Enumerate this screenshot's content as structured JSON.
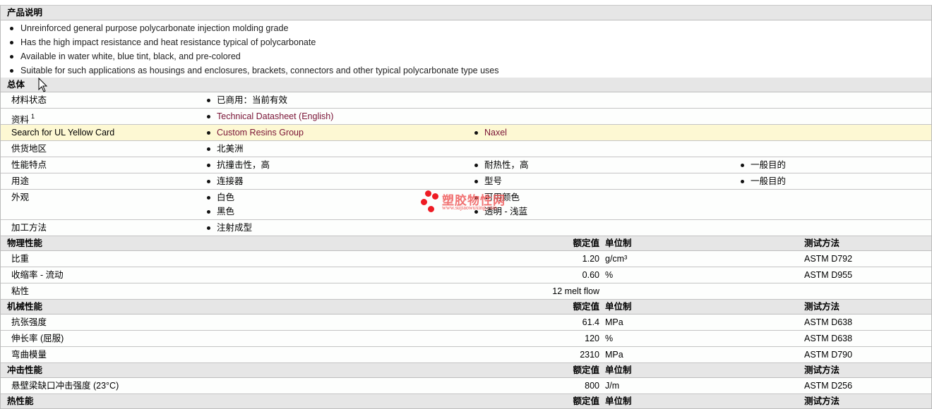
{
  "description": {
    "title": "产品说明",
    "items": [
      "Unreinforced general purpose polycarbonate injection molding grade",
      "Has the high impact resistance and heat resistance typical of polycarbonate",
      "Available in water white, blue tint, black, and pre-colored",
      "Suitable for such applications as housings and enclosures, brackets, connectors and other typical polycarbonate type uses"
    ]
  },
  "general": {
    "title": "总体",
    "rows": [
      {
        "label": "材料状态",
        "values": [
          "已商用：当前有效"
        ]
      },
      {
        "label": "资料",
        "sup": "1",
        "values": [
          "Technical Datasheet (English)"
        ]
      },
      {
        "label": "Search for UL Yellow Card",
        "values": [
          "Custom Resins Group",
          "Naxel"
        ]
      },
      {
        "label": "供货地区",
        "values": [
          "北美洲"
        ]
      },
      {
        "label": "性能特点",
        "values": [
          "抗撞击性，高",
          "耐热性，高",
          "一般目的"
        ]
      },
      {
        "label": "用途",
        "values": [
          "连接器",
          "型号",
          "一般目的"
        ]
      },
      {
        "label": "外观",
        "values": [
          "白色",
          "黑色",
          "可用颜色",
          "透明 - 浅蓝"
        ]
      },
      {
        "label": "加工方法",
        "values": [
          "注射成型"
        ]
      }
    ]
  },
  "col_headers": {
    "value": "额定值",
    "unit": "单位制",
    "method": "测试方法"
  },
  "physical": {
    "title": "物理性能",
    "rows": [
      {
        "label": "比重",
        "value": "1.20",
        "unit": "g/cm³",
        "method": "ASTM D792"
      },
      {
        "label": "收缩率 - 流动",
        "value": "0.60",
        "unit": "%",
        "method": "ASTM D955"
      },
      {
        "label": "粘性",
        "value": "12 melt flow",
        "unit": "",
        "method": ""
      }
    ]
  },
  "mechanical": {
    "title": "机械性能",
    "rows": [
      {
        "label": "抗张强度",
        "value": "61.4",
        "unit": "MPa",
        "method": "ASTM D638"
      },
      {
        "label": "伸长率 (屈服)",
        "value": "120",
        "unit": "%",
        "method": "ASTM D638"
      },
      {
        "label": "弯曲模量",
        "value": "2310",
        "unit": "MPa",
        "method": "ASTM D790"
      }
    ]
  },
  "impact": {
    "title": "冲击性能",
    "rows": [
      {
        "label": "悬壁梁缺口冲击强度 (23°C)",
        "value": "800",
        "unit": "J/m",
        "method": "ASTM D256"
      }
    ]
  },
  "thermal": {
    "title": "热性能"
  },
  "watermark": {
    "name": "塑胶物性网",
    "url": "www.sujiaowuxing.com"
  }
}
